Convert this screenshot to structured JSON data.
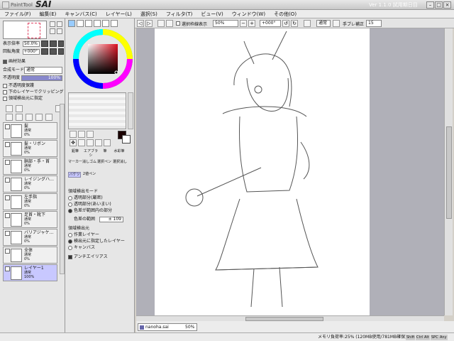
{
  "window": {
    "title": "PaintTool",
    "app_name": "SAI",
    "version": "Ver 1.1.0 試用期日目"
  },
  "menu": [
    "ファイル(F)",
    "編集(E)",
    "キャンバス(C)",
    "レイヤー(L)",
    "選択(S)",
    "フィルタ(T)",
    "ビュー(V)",
    "ウィンドウ(W)",
    "その他(O)"
  ],
  "toolbar": {
    "selection_label": "選択枠線表示",
    "zoom": "50%",
    "rotation": "+000°",
    "blend": "通常",
    "stabilizer_label": "手ブレ補正",
    "stabilizer_value": "15"
  },
  "navigator": {
    "zoom_label": "表示倍率",
    "zoom_value": "50.0%",
    "angle_label": "回転角度",
    "angle_value": "+000°"
  },
  "layer_panel": {
    "effects_label": "画材効果",
    "mode_label": "合成モード",
    "mode_value": "通常",
    "opacity_label": "不透明度",
    "opacity_value": "100%",
    "options": [
      "不透明度保護",
      "下のレイヤーでクリッピング",
      "領域検出元に指定"
    ]
  },
  "layers": [
    {
      "name": "髪",
      "mode": "通常",
      "opacity": "0%"
    },
    {
      "name": "髪・リボン",
      "mode": "通常",
      "opacity": "0%"
    },
    {
      "name": "胴部・手・首",
      "mode": "通常",
      "opacity": "0%"
    },
    {
      "name": "レイジングハ…",
      "mode": "通常",
      "opacity": "0%"
    },
    {
      "name": "左手指",
      "mode": "通常",
      "opacity": "0%"
    },
    {
      "name": "足首・靴下",
      "mode": "通常",
      "opacity": "0%"
    },
    {
      "name": "バリアジャケ…",
      "mode": "通常",
      "opacity": "0%"
    },
    {
      "name": "全体",
      "mode": "通常",
      "opacity": "0%"
    },
    {
      "name": "レイヤー1",
      "mode": "通常",
      "opacity": "100%"
    }
  ],
  "tools": {
    "row1": [
      "鉛筆",
      "エアブラシ",
      "筆",
      "水彩筆"
    ],
    "row2": [
      "マーカー",
      "消しゴム",
      "選択ペン",
      "選択消し"
    ],
    "row3": [
      "バケツ",
      "2値ペン"
    ]
  },
  "fill_options": {
    "detect_label": "領域検出モード",
    "detect_options": [
      "透明部分(厳密)",
      "透明部分(あいまい)",
      "色差が範囲内の部分"
    ],
    "range_label": "色差の範囲",
    "range_value": "± 109",
    "source_label": "領域検出元",
    "source_options": [
      "作業レイヤー",
      "検出元に指定したレイヤー",
      "キャンバス"
    ],
    "antialias_label": "アンチエイリアス"
  },
  "file_tab": {
    "name": "nanoha.sai",
    "zoom": "50%"
  },
  "status": {
    "memory": "メモリ負荷率:25% (120MB使用/781MB確保)",
    "keys": [
      "Shift",
      "Ctrl",
      "Alt",
      "SPC",
      "Any"
    ]
  },
  "colors": {
    "current": "#1a0000",
    "accent": "#c8c8ff"
  }
}
